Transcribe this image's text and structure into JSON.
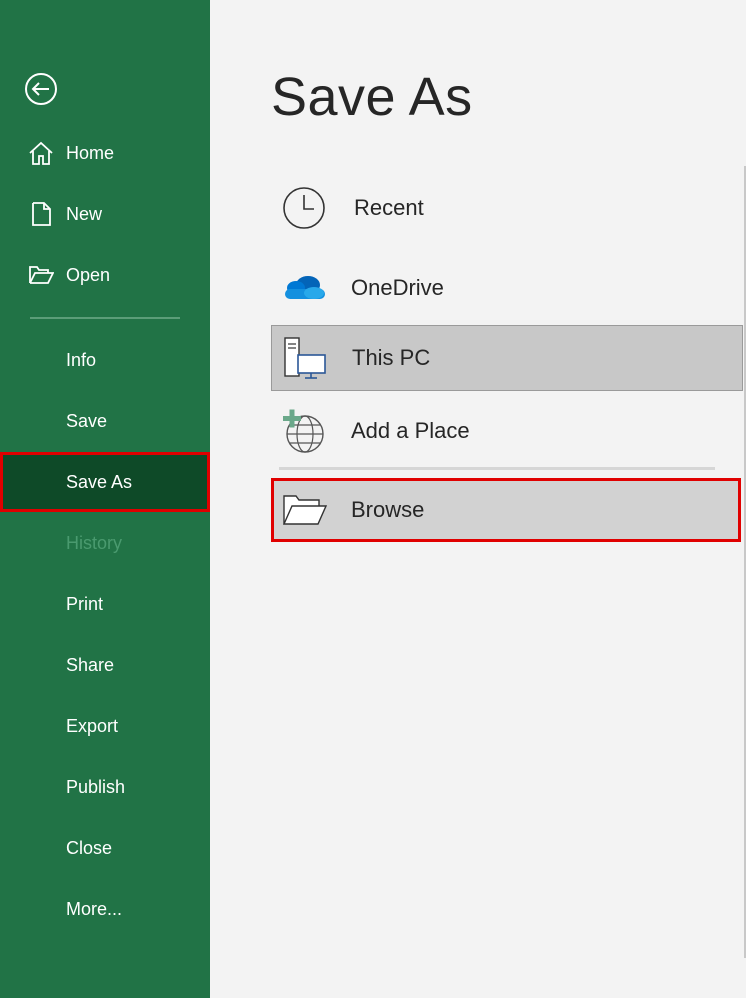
{
  "sidebar": {
    "items": [
      {
        "label": "Home"
      },
      {
        "label": "New"
      },
      {
        "label": "Open"
      },
      {
        "label": "Info"
      },
      {
        "label": "Save"
      },
      {
        "label": "Save As"
      },
      {
        "label": "History"
      },
      {
        "label": "Print"
      },
      {
        "label": "Share"
      },
      {
        "label": "Export"
      },
      {
        "label": "Publish"
      },
      {
        "label": "Close"
      },
      {
        "label": "More..."
      }
    ],
    "selected": "Save As",
    "disabled": [
      "History"
    ]
  },
  "main": {
    "title": "Save As",
    "locations": [
      {
        "label": "Recent",
        "icon": "clock-icon"
      },
      {
        "label": "OneDrive",
        "icon": "onedrive-cloud-icon"
      },
      {
        "label": "This PC",
        "icon": "computer-icon"
      },
      {
        "label": "Add a Place",
        "icon": "add-globe-icon"
      },
      {
        "label": "Browse",
        "icon": "folder-icon"
      }
    ]
  },
  "colors": {
    "sidebar_bg": "#217346",
    "sidebar_selected": "#0e4a28",
    "highlight_border": "#e00000",
    "main_bg": "#f3f3f3"
  }
}
